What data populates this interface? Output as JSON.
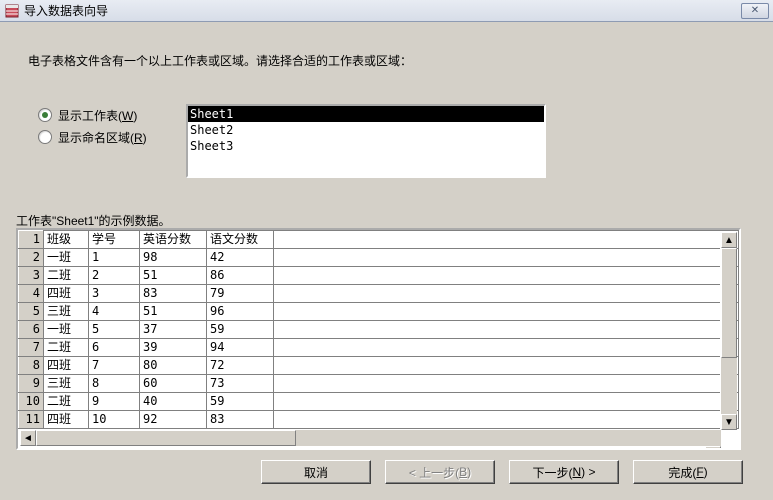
{
  "window": {
    "title": "导入数据表向导",
    "close": "✕"
  },
  "message": "电子表格文件含有一个以上工作表或区域。请选择合适的工作表或区域：",
  "radios": {
    "show_sheets_pre": "显示工作表(",
    "show_sheets_key": "W",
    "show_sheets_post": ")",
    "show_ranges_pre": "显示命名区域(",
    "show_ranges_key": "R",
    "show_ranges_post": ")",
    "selected": "sheets"
  },
  "listbox": {
    "items": [
      "Sheet1",
      "Sheet2",
      "Sheet3"
    ],
    "selected_index": 0
  },
  "sample_label": "工作表\"Sheet1\"的示例数据。",
  "grid": {
    "headers": [
      "班级",
      "学号",
      "英语分数",
      "语文分数"
    ],
    "rows": [
      [
        "一班",
        "1",
        "98",
        "42"
      ],
      [
        "二班",
        "2",
        "51",
        "86"
      ],
      [
        "四班",
        "3",
        "83",
        "79"
      ],
      [
        "三班",
        "4",
        "51",
        "96"
      ],
      [
        "一班",
        "5",
        "37",
        "59"
      ],
      [
        "二班",
        "6",
        "39",
        "94"
      ],
      [
        "四班",
        "7",
        "80",
        "72"
      ],
      [
        "三班",
        "8",
        "60",
        "73"
      ],
      [
        "二班",
        "9",
        "40",
        "59"
      ],
      [
        "四班",
        "10",
        "92",
        "83"
      ]
    ]
  },
  "buttons": {
    "cancel": "取消",
    "back_pre": "< 上一步(",
    "back_key": "B",
    "back_post": ")",
    "next_pre": "下一步(",
    "next_key": "N",
    "next_post": ") >",
    "finish_pre": "完成(",
    "finish_key": "F",
    "finish_post": ")"
  },
  "chart_data": {
    "type": "table",
    "title": "工作表\"Sheet1\"的示例数据",
    "columns": [
      "班级",
      "学号",
      "英语分数",
      "语文分数"
    ],
    "rows": [
      [
        "一班",
        1,
        98,
        42
      ],
      [
        "二班",
        2,
        51,
        86
      ],
      [
        "四班",
        3,
        83,
        79
      ],
      [
        "三班",
        4,
        51,
        96
      ],
      [
        "一班",
        5,
        37,
        59
      ],
      [
        "二班",
        6,
        39,
        94
      ],
      [
        "四班",
        7,
        80,
        72
      ],
      [
        "三班",
        8,
        60,
        73
      ],
      [
        "二班",
        9,
        40,
        59
      ],
      [
        "四班",
        10,
        92,
        83
      ]
    ]
  }
}
